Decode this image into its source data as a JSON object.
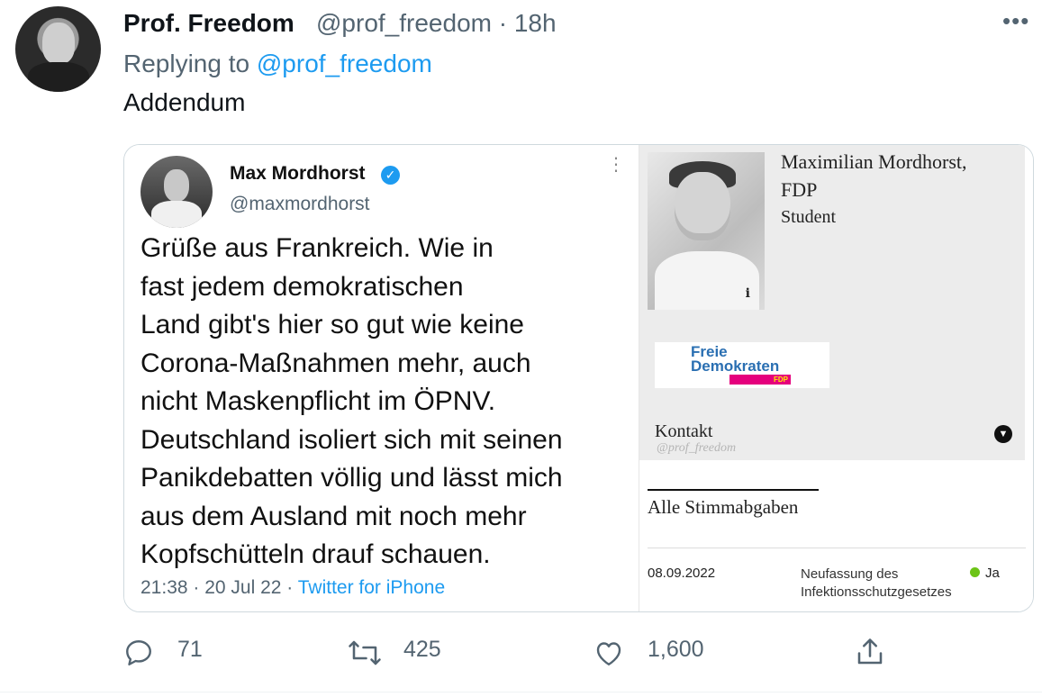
{
  "tweet": {
    "author_name": "Prof. Freedom",
    "author_handle": "@prof_freedom",
    "separator": "·",
    "time": "18h",
    "more": "•••",
    "replying_label": "Replying to",
    "replying_handle": "@prof_freedom",
    "text": "Addendum"
  },
  "quoted": {
    "name": "Max Mordhorst",
    "verified": "✓",
    "handle": "@maxmordhorst",
    "more": "⋮",
    "lines": [
      "Grüße aus Frankreich. Wie in",
      "fast jedem demokratischen",
      "Land gibt's hier so gut wie keine",
      "Corona-Maßnahmen mehr, auch",
      "nicht Maskenpflicht im ÖPNV.",
      "Deutschland isoliert sich mit seinen",
      "Panikdebatten völlig und lässt mich",
      "aus dem Ausland mit noch mehr",
      "Kopfschütteln drauf schauen."
    ],
    "timestamp": "21:38 · 20 Jul 22 · ",
    "source": "Twitter for iPhone"
  },
  "profile": {
    "name_line1": "Maximilian Mordhorst,",
    "name_line2": "FDP",
    "occupation": "Student",
    "photo_info": "i",
    "logo_line1": "Freie",
    "logo_line2": "Demokraten",
    "logo_bar": "FDP",
    "contact_label": "Kontakt",
    "watermark": "@prof_freedom",
    "votes_heading": "Alle Stimmabgaben",
    "vote": {
      "date": "08.09.2022",
      "law": "Neufassung des Infektionsschutzgesetzes",
      "result": "Ja",
      "result_color": "#6cc417"
    }
  },
  "actions": {
    "replies": "71",
    "retweets": "425",
    "likes": "1,600"
  },
  "colors": {
    "link": "#1d9bf0",
    "secondary_text": "#536471"
  }
}
